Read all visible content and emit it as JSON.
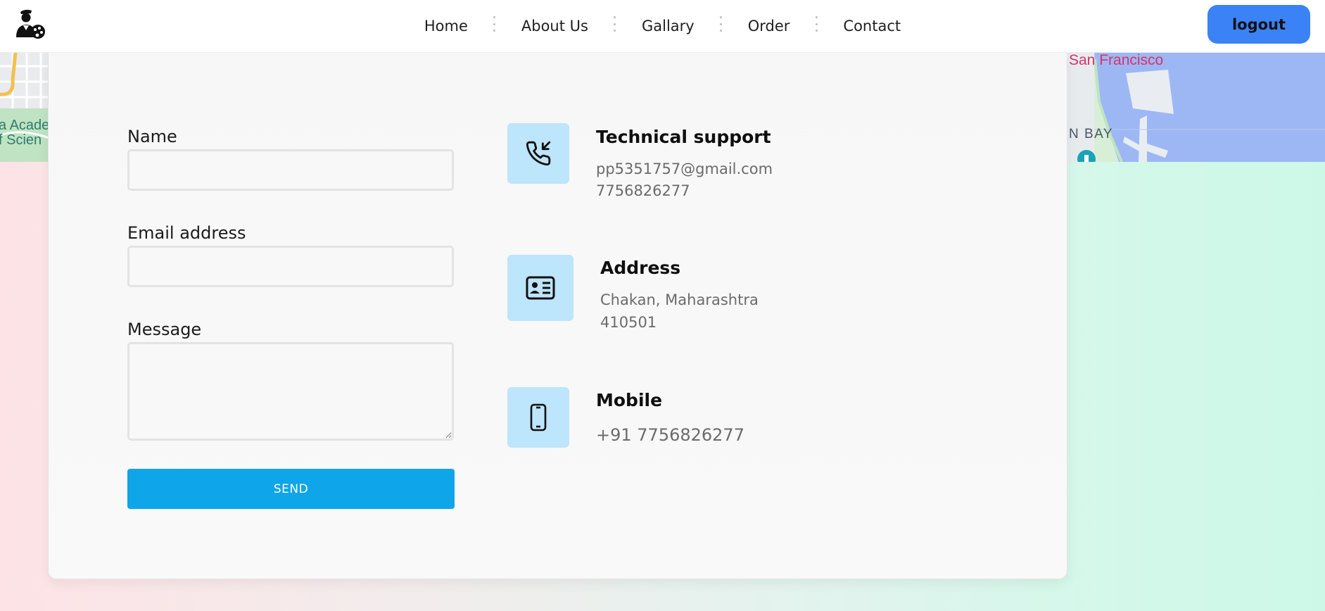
{
  "nav": {
    "items": [
      {
        "label": "Home"
      },
      {
        "label": "About Us"
      },
      {
        "label": "Gallary"
      },
      {
        "label": "Order"
      },
      {
        "label": "Contact"
      }
    ],
    "logout_label": "logout",
    "logo_icon": "artist-avatar-icon"
  },
  "map": {
    "labels": {
      "academy_line1": "a Acade",
      "academy_line2": "f Scien",
      "city": "San Francisco",
      "bay": "N BAY"
    },
    "colors": {
      "water": "#9db7f5",
      "park": "#bfe3c3",
      "road": "#f4f4f4",
      "city_label": "#d6336c"
    }
  },
  "form": {
    "name_label": "Name",
    "name_value": "",
    "email_label": "Email address",
    "email_value": "",
    "message_label": "Message",
    "message_value": "",
    "send_label": "SEND"
  },
  "info": {
    "technical": {
      "title": "Technical support",
      "email": "pp5351757@gmail.com",
      "phone": "7756826277",
      "icon": "phone-incoming-icon"
    },
    "address": {
      "title": "Address",
      "line1": "Chakan, Maharashtra",
      "line2": "410501",
      "icon": "address-card-icon"
    },
    "mobile": {
      "title": "Mobile",
      "number": "+91 7756826277",
      "icon": "smartphone-icon"
    }
  },
  "colors": {
    "accent_blue": "#3b82f6",
    "send_blue": "#0ea5e9",
    "icon_box": "#bde5fb"
  }
}
